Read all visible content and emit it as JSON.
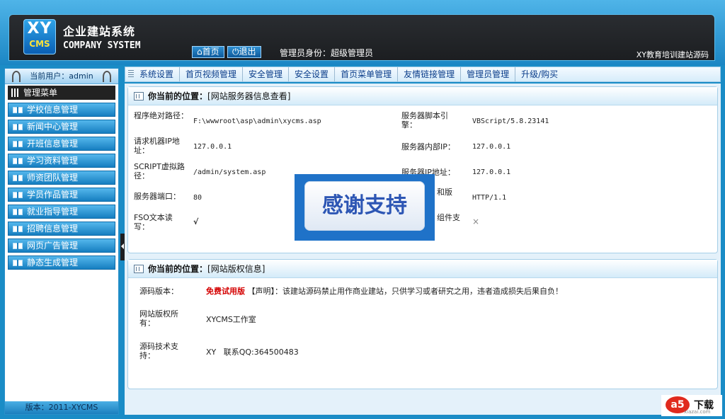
{
  "header": {
    "logo_top": "XY",
    "logo_bottom": "CMS",
    "brand_cn": "企业建站系统",
    "brand_en": "COMPANY SYSTEM",
    "nav_home": "首页",
    "nav_logout": "退出",
    "admin_role": "管理员身份：超级管理员",
    "site_tag": "XY教育培训建站源码"
  },
  "sidebar": {
    "current_user": "当前用户：admin",
    "menu_head": "管理菜单",
    "items": [
      "学校信息管理",
      "新闻中心管理",
      "开班信息管理",
      "学习资料管理",
      "师资团队管理",
      "学员作品管理",
      "就业指导管理",
      "招聘信息管理",
      "网页广告管理",
      "静态生成管理"
    ],
    "version": "版本：2011-XYCMS"
  },
  "topmenu": [
    "系统设置",
    "首页视频管理",
    "安全管理",
    "安全设置",
    "首页菜单管理",
    "友情链接管理",
    "管理员管理",
    "升级/购买"
  ],
  "server_panel": {
    "title_prefix": "你当前的位置：",
    "title_text": "[网站服务器信息查看]",
    "rows": [
      {
        "label_l": "程序绝对路径：",
        "value_l": "F:\\wwwroot\\asp\\admin\\xycms.asp",
        "label_r": "服务器脚本引擎：",
        "value_r": "VBScript/5.8.23141"
      },
      {
        "label_l": "请求机器IP地址：",
        "value_l": "127.0.0.1",
        "label_r": "服务器内部IP：",
        "value_r": "127.0.0.1"
      },
      {
        "label_l": "SCRIPT虚拟路径：",
        "value_l": "/admin/system.asp",
        "label_r": "服务器IP地址：",
        "value_r": "127.0.0.1"
      },
      {
        "label_l": "服务器端口：",
        "value_l": "80",
        "label_r": "和版",
        "value_r": "HTTP/1.1"
      },
      {
        "label_l": "FSO文本读写：",
        "value_l": "√",
        "label_r": "组件支",
        "value_r": "×"
      }
    ]
  },
  "copyright_panel": {
    "title_prefix": "你当前的位置：",
    "title_text": "[网站版权信息]",
    "source_label": "源码版本：",
    "free_text": "免费试用版",
    "notice": "【声明】：该建站源码禁止用作商业建站，只供学习或者研究之用，违者造成损失后果自负！",
    "owner_label": "网站版权所有：",
    "owner_value": "XYCMS工作室",
    "support_label": "源码技术支持：",
    "support_value": "XY   联系QQ:364500483"
  },
  "overlay": {
    "text": "感谢支持"
  },
  "watermark": {
    "logo": "a5",
    "text": "下载",
    "url": "xiazai.com"
  }
}
